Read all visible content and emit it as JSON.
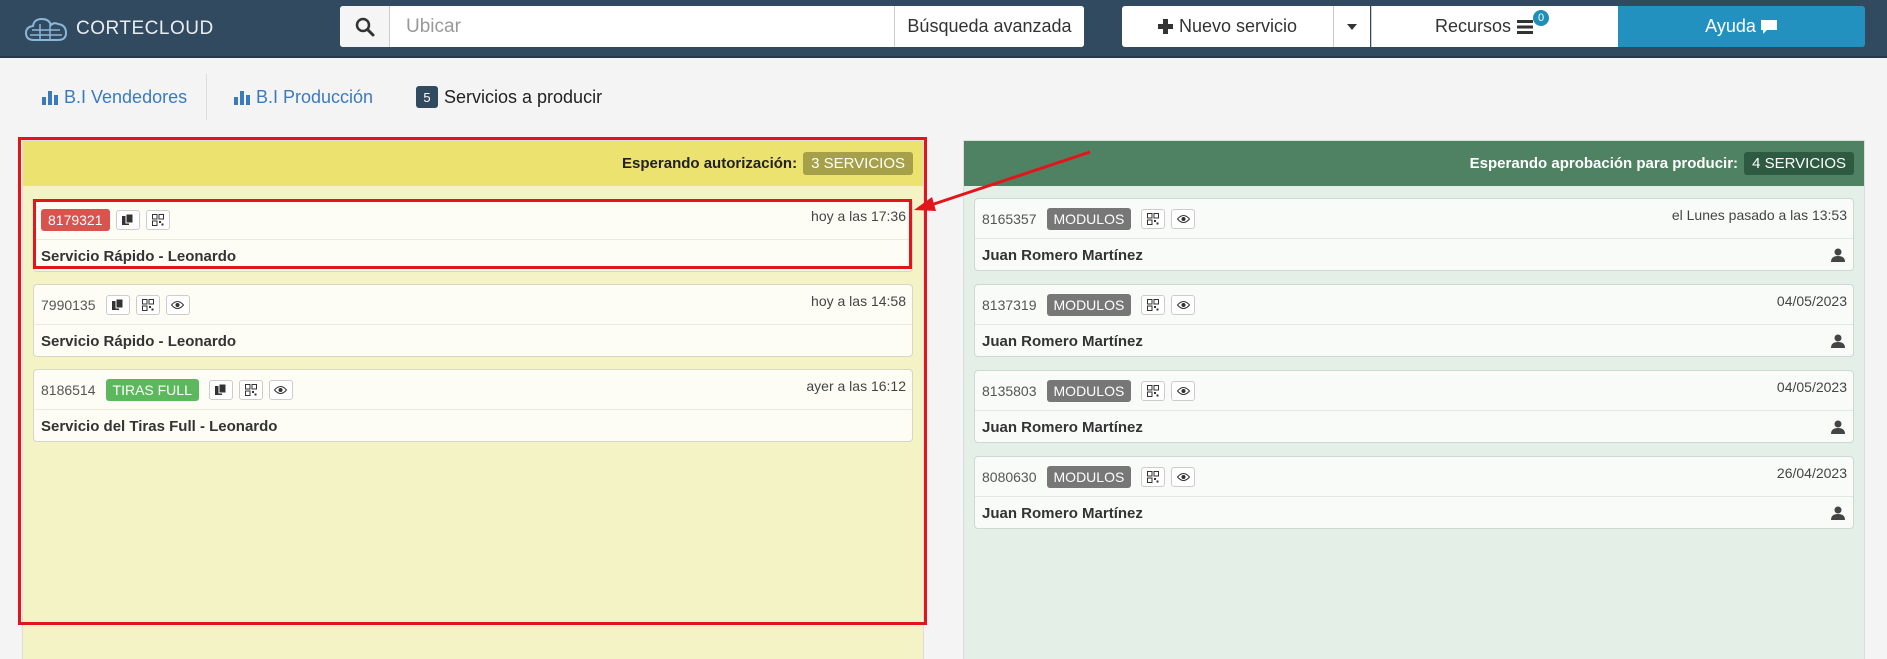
{
  "app": {
    "name": "CORTECLOUD"
  },
  "search": {
    "placeholder": "Ubicar",
    "advanced_label": "Búsqueda avanzada"
  },
  "toolbar": {
    "new_service_label": "Nuevo servicio",
    "resources_label": "Recursos",
    "resources_count": "0",
    "help_label": "Ayuda"
  },
  "tabs": [
    {
      "label": "B.I Vendedores"
    },
    {
      "label": "B.I Producción"
    },
    {
      "label": "Servicios a producir",
      "count": "5"
    }
  ],
  "columns": {
    "left": {
      "header": "Esperando autorización:",
      "badge": "3 SERVICIOS",
      "cards": [
        {
          "id": "8179321",
          "time": "hoy a las 17:36",
          "title": "Servicio Rápido - Leonardo"
        },
        {
          "id": "7990135",
          "time": "hoy a las 14:58",
          "title": "Servicio Rápido - Leonardo"
        },
        {
          "id": "8186514",
          "tag": "TIRAS FULL",
          "time": "ayer a las 16:12",
          "title": "Servicio del Tiras Full - Leonardo"
        }
      ]
    },
    "right": {
      "header": "Esperando aprobación para producir:",
      "badge": "4 SERVICIOS",
      "cards": [
        {
          "id": "8165357",
          "tag": "MODULOS",
          "time": "el Lunes pasado a las 13:53",
          "title": "Juan Romero Martínez"
        },
        {
          "id": "8137319",
          "tag": "MODULOS",
          "time": "04/05/2023",
          "title": "Juan Romero Martínez"
        },
        {
          "id": "8135803",
          "tag": "MODULOS",
          "time": "04/05/2023",
          "title": "Juan Romero Martínez"
        },
        {
          "id": "8080630",
          "tag": "MODULOS",
          "time": "26/04/2023",
          "title": "Juan Romero Martínez"
        }
      ]
    }
  },
  "colors": {
    "topbar": "#324a5f",
    "accent": "#2391bf",
    "left_header": "#ebe26f",
    "right_header": "#4e8262",
    "alert_red": "#d9534f",
    "tag_green": "#5cb85c",
    "annotation": "#e3141b"
  },
  "icons": [
    "cloud-logo-icon",
    "search-icon",
    "plus-icon",
    "caret-down-icon",
    "list-icon",
    "chat-icon",
    "bar-chart-icon",
    "copy-icon",
    "qr-icon",
    "eye-icon",
    "user-icon"
  ]
}
